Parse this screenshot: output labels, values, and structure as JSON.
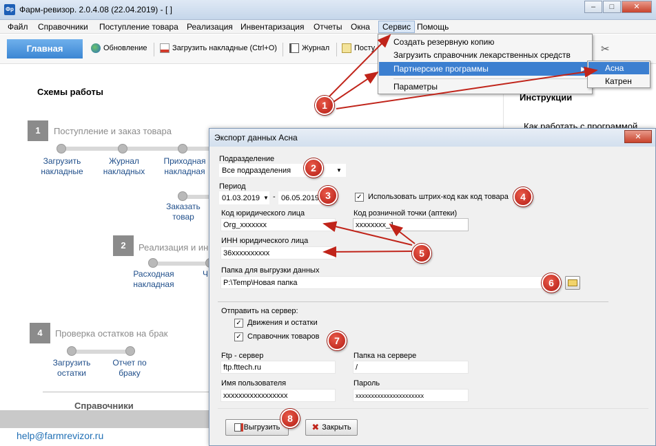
{
  "window": {
    "app_icon": "Фр",
    "title": "Фарм-ревизор. 2.0.4.08 (22.04.2019) - [ ]",
    "controls": [
      "–",
      "□",
      "✕"
    ]
  },
  "menubar": [
    "Файл",
    "Справочники",
    "Поступление товара",
    "Реализация",
    "Инвентаризация",
    "Отчеты",
    "Окна",
    "Сервис",
    "Помощь"
  ],
  "toolbar": {
    "main_tab": "Главная",
    "buttons": [
      "Обновление",
      "Загрузить накладные (Ctrl+O)",
      "Журнал",
      "Посту"
    ]
  },
  "service_menu": {
    "items": [
      "Создать резервную копию",
      "Загрузить справочник лекарственных средств",
      "Партнерские программы",
      "Параметры"
    ],
    "submenu": [
      "Асна",
      "Катрен"
    ]
  },
  "left": {
    "schema_title": "Схемы работы",
    "step1": {
      "num": "1",
      "title": "Поступление и заказ товара",
      "nodes": [
        "Загрузить\nнакладные",
        "Журнал\nнакладных",
        "Приходная\nнакладная"
      ],
      "order": "Заказать\nтовар"
    },
    "step2": {
      "num": "2",
      "title": "Реализация и ин",
      "nodes": [
        "Расходная\nнакладная",
        "Ч"
      ]
    },
    "step4": {
      "num": "4",
      "title": "Проверка остатков на брак",
      "nodes": [
        "Загрузить\nостатки",
        "Отчет по\nбраку"
      ]
    },
    "references": "Справочники",
    "email": "help@farmrevizor.ru"
  },
  "right": {
    "instructions": "Инструкции",
    "howto": "Как работать с программой"
  },
  "dialog": {
    "title": "Экспорт данных Асна",
    "close": "✕",
    "division_label": "Подразделение",
    "division_value": "Все подразделения",
    "period_label": "Период",
    "period_from": "01.03.2019",
    "period_dash": "-",
    "period_to": "06.05.2019",
    "use_barcode": "Использовать штрих-код как  код товара",
    "legal_code_label": "Код юридического лица",
    "legal_code_value": "Org_xxxxxxx",
    "retail_code_label": "Код розничной точки (аптеки)",
    "retail_code_value": "xxxxxxxx_1",
    "inn_label": "ИНН юридического лица",
    "inn_value": "36xxxxxxxxxx",
    "folder_label": "Папка для выгрузки данных",
    "folder_value": "P:\\Temp\\Новая папка",
    "send_label": "Отправить на сервер:",
    "chk_movements": "Движения и остатки",
    "chk_goods": "Справочник товаров",
    "ftp_label": "Ftp - сервер",
    "ftp_value": "ftp.fttech.ru",
    "server_folder_label": "Папка на сервере",
    "server_folder_value": "/",
    "user_label": "Имя пользователя",
    "user_value": "xxxxxxxxxxxxxxxxx",
    "password_label": "Пароль",
    "password_value": "xxxxxxxxxxxxxxxxxxxxxx",
    "export_button": "Выгрузить",
    "close_button": "Закрыть"
  },
  "markers": [
    "1",
    "2",
    "3",
    "4",
    "5",
    "6",
    "7",
    "8"
  ],
  "colors": {
    "accent": "#3c7fd0",
    "marker": "#c0241a",
    "arrow": "#c0241a"
  }
}
